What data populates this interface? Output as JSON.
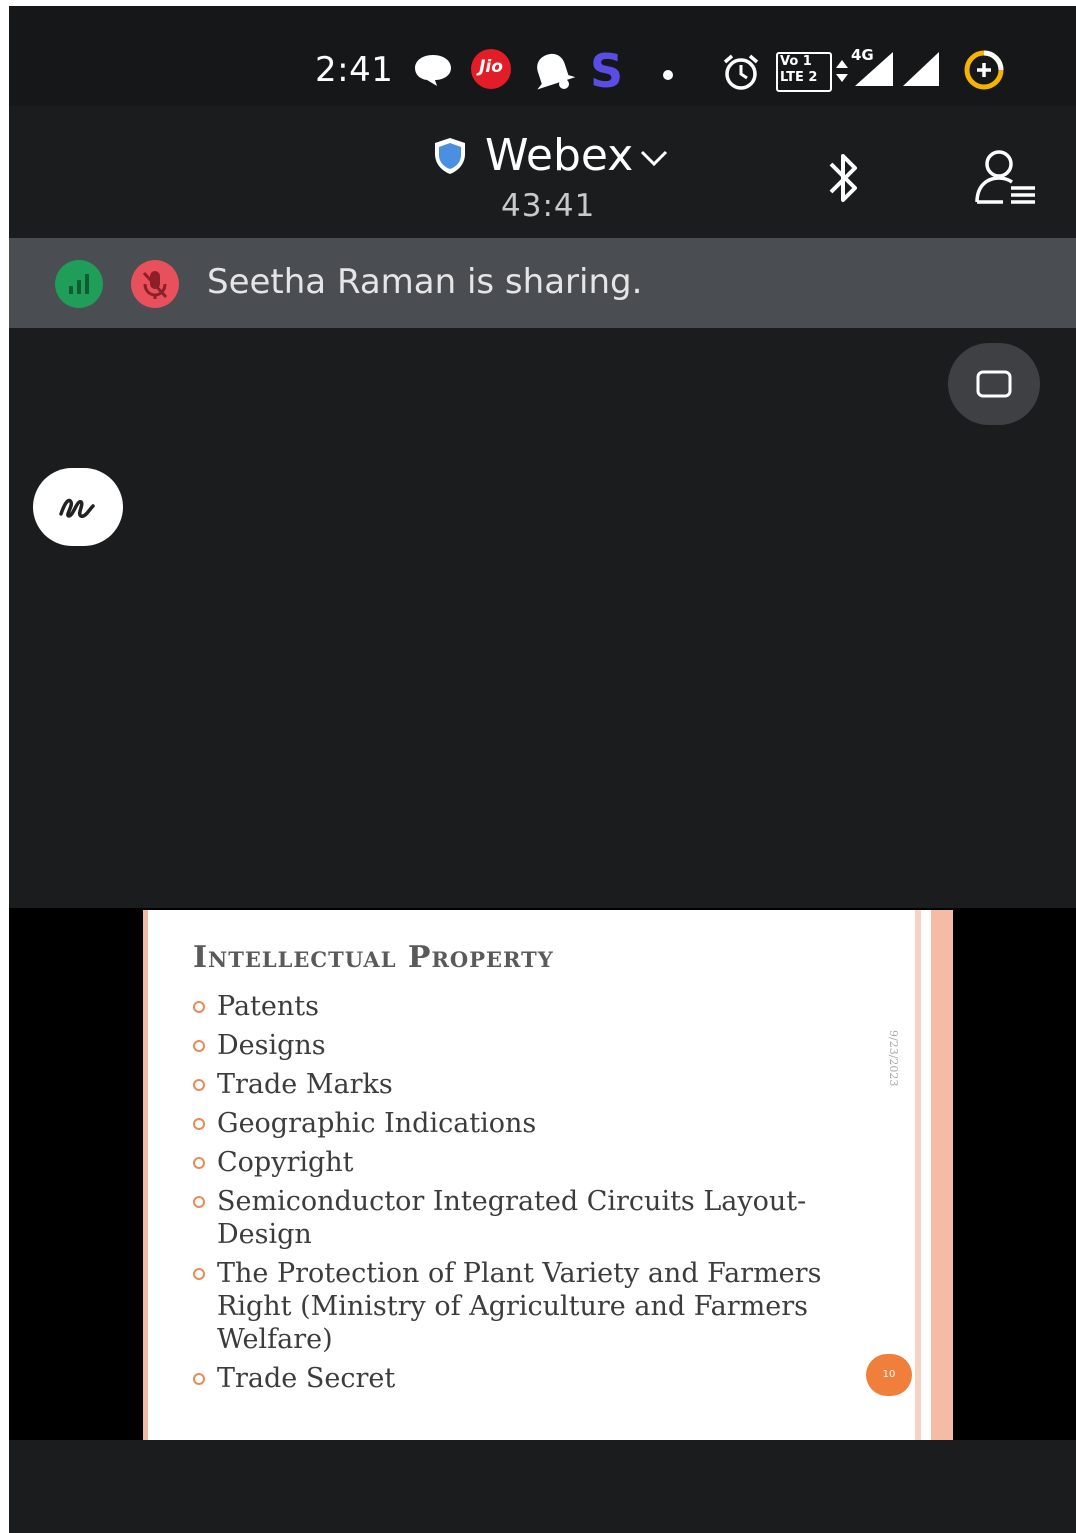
{
  "status_bar": {
    "time": "2:41",
    "carrier_badge": "Jio",
    "app_badge": "S",
    "volte_line1": "Vo 1",
    "volte_line2": "LTE 2",
    "network": "4G",
    "icons": [
      "chat-bubble-icon",
      "jio-icon",
      "notification-bell-icon",
      "s-app-icon",
      "dot-icon",
      "alarm-icon",
      "volte-icon",
      "data-arrows-icon",
      "signal-icon",
      "signal-2-icon",
      "battery-saver-icon"
    ]
  },
  "header": {
    "app_name": "Webex",
    "duration": "43:41",
    "icons": [
      "shield-icon",
      "chevron-down-icon",
      "bluetooth-icon",
      "participants-icon"
    ]
  },
  "banner": {
    "text": "Seetha Raman is sharing.",
    "icons": [
      "audio-level-icon",
      "muted-mic-icon"
    ]
  },
  "controls": {
    "icons": [
      "layout-toggle-icon",
      "annotate-icon"
    ]
  },
  "slide": {
    "title": "Intellectual Property",
    "date": "9/23/2023",
    "bullets": [
      "Patents",
      "Designs",
      "Trade Marks",
      "Geographic Indications",
      "Copyright",
      " Semiconductor Integrated Circuits Layout-Design",
      " The Protection of Plant Variety and Farmers Right (Ministry of Agriculture and Farmers Welfare)",
      "Trade Secret"
    ],
    "page_number": "10"
  },
  "colors": {
    "background": "#1b1c1e",
    "banner": "#4a4d51",
    "accent_orange": "#f07f3c",
    "muted_red": "#e8505b",
    "audio_green": "#1f9e5a",
    "shield_blue": "#4a8fe0"
  }
}
